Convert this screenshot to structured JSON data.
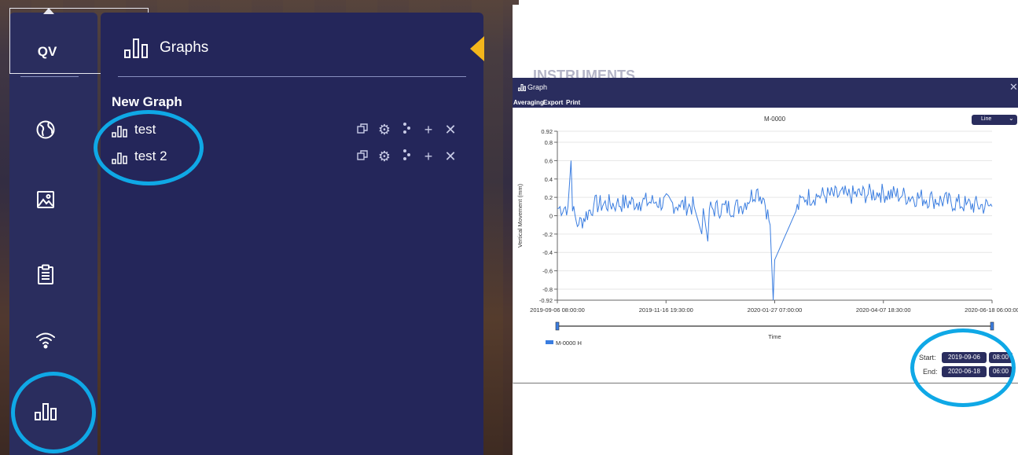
{
  "sidebar": {
    "logo": "QV",
    "nav_icons": [
      "globe-icon",
      "image-icon",
      "clipboard-icon",
      "wifi-icon",
      "bar-chart-icon"
    ]
  },
  "graphs_panel": {
    "title": "Graphs",
    "section": "New Graph",
    "items": [
      {
        "label": "test",
        "actions": [
          "copy-icon",
          "gear-icon",
          "share-icon",
          "add-icon",
          "close-icon"
        ]
      },
      {
        "label": "test 2",
        "actions": [
          "copy-icon",
          "gear-icon",
          "share-icon",
          "add-icon",
          "close-icon"
        ]
      }
    ],
    "accent_color": "#f3b61b"
  },
  "graph_window": {
    "background_title": "INSTRUMENTS",
    "title": "Graph",
    "menu": [
      "Averaging",
      "Export",
      "Print"
    ],
    "view_select": "Line",
    "start_label": "Start:",
    "start_date": "2019-09-06",
    "start_time": "08:00",
    "end_label": "End:",
    "end_date": "2020-06-18",
    "end_time": "06:00"
  },
  "highlight_color": "#0fa8e6",
  "chart_data": {
    "type": "line",
    "title": "M-0000",
    "xlabel": "Time",
    "ylabel": "Vertical Movement (mm)",
    "ylim": [
      -0.92,
      0.92
    ],
    "y_ticks": [
      "0.92",
      "0.8",
      "0.6",
      "0.4",
      "0.2",
      "0",
      "-0.2",
      "-0.4",
      "-0.6",
      "-0.8",
      "-0.92"
    ],
    "x_ticks": [
      "2019-09-06 08:00:00",
      "2019-11-16 19:30:00",
      "2020-01-27 07:00:00",
      "2020-04-07 18:30:00",
      "2020-06-18 06:00:00"
    ],
    "grid": "horizontal",
    "legend": "bottom-left",
    "series": [
      {
        "name": "M-0000 H",
        "color": "#3a7de0",
        "points": [
          [
            "2019-09-06",
            0.08
          ],
          [
            "2019-09-13",
            0.1
          ],
          [
            "2019-09-15",
            0.6
          ],
          [
            "2019-09-16",
            0.05
          ],
          [
            "2019-09-20",
            -0.1
          ],
          [
            "2019-09-30",
            0.12
          ],
          [
            "2019-10-15",
            0.13
          ],
          [
            "2019-10-30",
            0.15
          ],
          [
            "2019-11-10",
            0.15
          ],
          [
            "2019-11-25",
            0.12
          ],
          [
            "2019-12-05",
            0.1
          ],
          [
            "2019-12-10",
            -0.2
          ],
          [
            "2019-12-11",
            0.08
          ],
          [
            "2019-12-14",
            -0.28
          ],
          [
            "2019-12-15",
            0.07
          ],
          [
            "2020-01-05",
            0.1
          ],
          [
            "2020-01-15",
            0.28
          ],
          [
            "2020-01-20",
            0.18
          ],
          [
            "2020-01-24",
            -0.1
          ],
          [
            "2020-01-26",
            -0.92
          ],
          [
            "2020-01-27",
            -0.48
          ],
          [
            "2020-02-10",
            0.05
          ],
          [
            "2020-02-15",
            0.2
          ],
          [
            "2020-02-25",
            0.22
          ],
          [
            "2020-03-15",
            0.22
          ],
          [
            "2020-04-05",
            0.25
          ],
          [
            "2020-04-20",
            0.22
          ],
          [
            "2020-05-10",
            0.18
          ],
          [
            "2020-06-01",
            0.12
          ],
          [
            "2020-06-18",
            0.1
          ]
        ]
      }
    ]
  }
}
